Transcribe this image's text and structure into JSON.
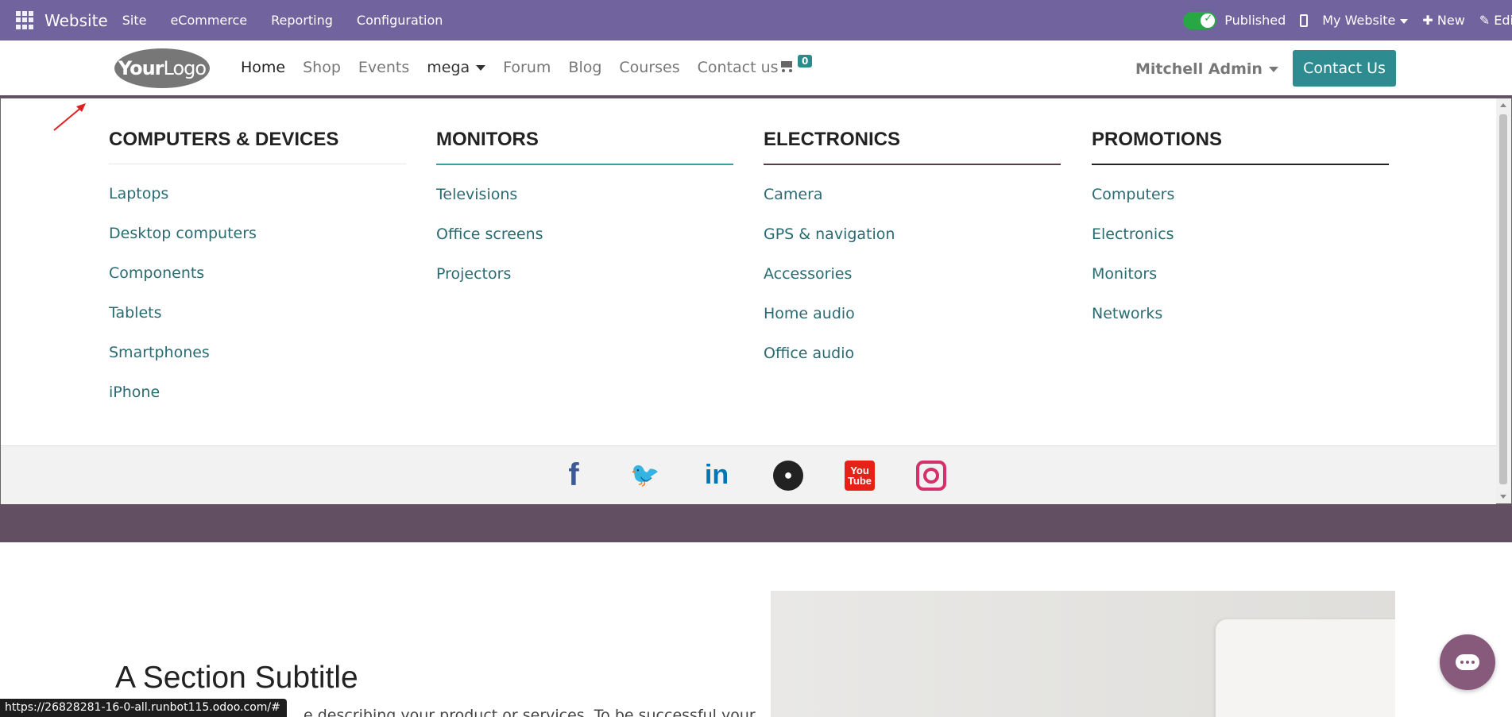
{
  "adminbar": {
    "brand": "Website",
    "menu": [
      "Site",
      "eCommerce",
      "Reporting",
      "Configuration"
    ],
    "published_label": "Published",
    "website_selector": "My Website",
    "new_label": "New",
    "edit_label": "Edi"
  },
  "header": {
    "logo_bold": "Your",
    "logo_text": "Logo",
    "nav": [
      "Home",
      "Shop",
      "Events",
      "mega",
      "Forum",
      "Blog",
      "Courses",
      "Contact us"
    ],
    "cart_count": "0",
    "user_name": "Mitchell Admin",
    "contact_button": "Contact Us"
  },
  "mega_menu": {
    "columns": [
      {
        "title": "COMPUTERS & DEVICES",
        "items": [
          "Laptops",
          "Desktop computers",
          "Components",
          "Tablets",
          "Smartphones",
          "iPhone"
        ]
      },
      {
        "title": "MONITORS",
        "items": [
          "Televisions",
          "Office screens",
          "Projectors"
        ]
      },
      {
        "title": "ELECTRONICS",
        "items": [
          "Camera",
          "GPS & navigation",
          "Accessories",
          "Home audio",
          "Office audio"
        ]
      },
      {
        "title": "PROMOTIONS",
        "items": [
          "Computers",
          "Electronics",
          "Monitors",
          "Networks"
        ]
      }
    ],
    "social": [
      "facebook-icon",
      "twitter-icon",
      "linkedin-icon",
      "github-icon",
      "youtube-icon",
      "instagram-icon"
    ],
    "youtube_text_1": "You",
    "youtube_text_2": "Tube"
  },
  "content": {
    "subtitle": "A Section Subtitle",
    "body_text": "e describing your product or services. To be successful your"
  },
  "statusbar": {
    "url": "https://26828281-16-0-all.runbot115.odoo.com/#"
  },
  "colors": {
    "admin_bar": "#71639e",
    "accent": "#2e8b8f",
    "header_border": "#624f62"
  }
}
